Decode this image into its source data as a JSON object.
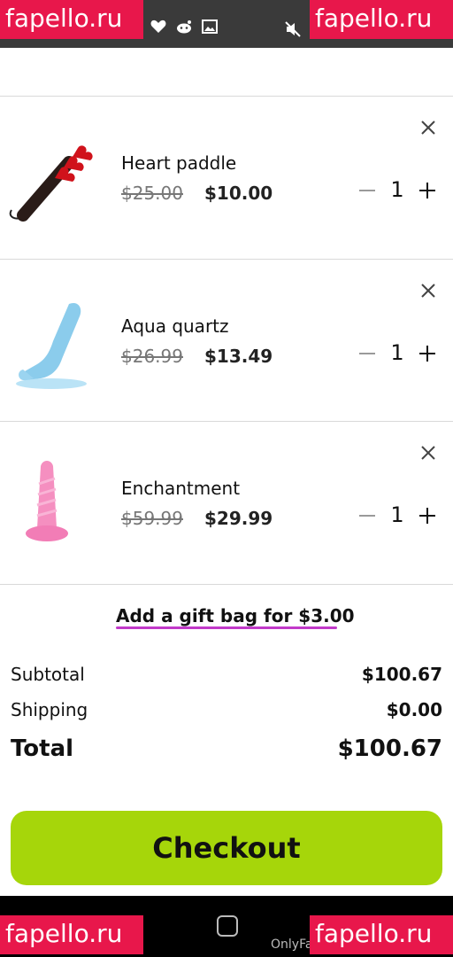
{
  "status_bar": {
    "left_icons": [
      "heart-icon",
      "reddit-icon",
      "image-icon"
    ],
    "right_icons": [
      "mute-icon"
    ]
  },
  "watermark": {
    "text": "fapello.ru",
    "color": "#e8174b"
  },
  "cart": {
    "items": [
      {
        "name": "Heart paddle",
        "original_price": "$25.00",
        "price": "$10.00",
        "quantity": "1",
        "image": "heart-paddle-image"
      },
      {
        "name": "Aqua quartz",
        "original_price": "$26.99",
        "price": "$13.49",
        "quantity": "1",
        "image": "aqua-quartz-image"
      },
      {
        "name": "Enchantment",
        "original_price": "$59.99",
        "price": "$29.99",
        "quantity": "1",
        "image": "enchantment-image"
      }
    ]
  },
  "gift_bag": {
    "label": "Add a gift bag for $3.00",
    "underline_color": "#c23ac9"
  },
  "summary": {
    "subtotal_label": "Subtotal",
    "subtotal_value": "$100.67",
    "shipping_label": "Shipping",
    "shipping_value": "$0.00",
    "total_label": "Total",
    "total_value": "$100.67"
  },
  "checkout": {
    "label": "Checkout",
    "color": "#a6d60a"
  },
  "nav_bar": {
    "footer_text": "OnlyFa"
  }
}
